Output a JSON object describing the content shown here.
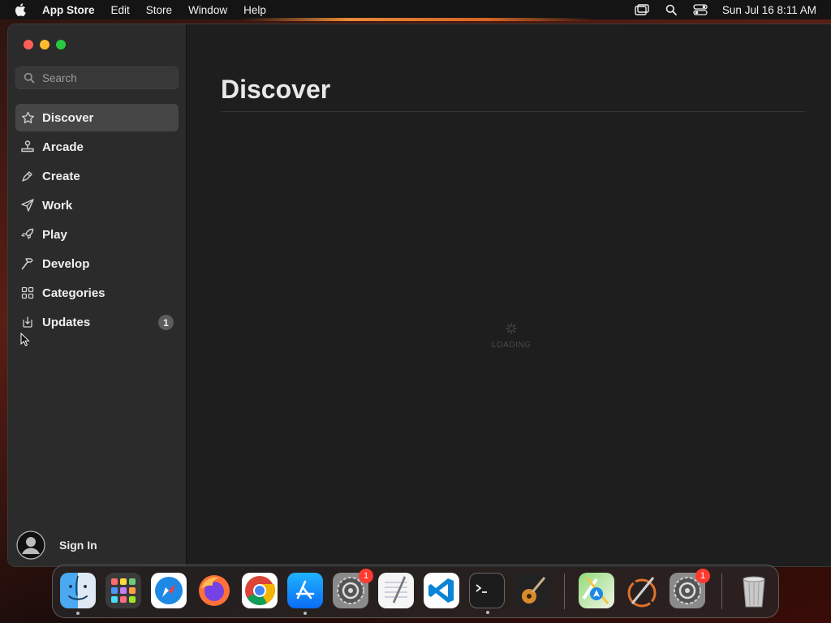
{
  "menubar": {
    "app_name": "App Store",
    "items": [
      "Edit",
      "Store",
      "Window",
      "Help"
    ],
    "clock": "Sun Jul 16  8:11 AM"
  },
  "sidebar": {
    "search_placeholder": "Search",
    "items": [
      {
        "label": "Discover",
        "icon": "star-icon",
        "active": true
      },
      {
        "label": "Arcade",
        "icon": "joystick-icon"
      },
      {
        "label": "Create",
        "icon": "brush-icon"
      },
      {
        "label": "Work",
        "icon": "paper-plane-icon"
      },
      {
        "label": "Play",
        "icon": "rocket-icon"
      },
      {
        "label": "Develop",
        "icon": "hammer-icon"
      },
      {
        "label": "Categories",
        "icon": "grid-icon"
      },
      {
        "label": "Updates",
        "icon": "download-icon",
        "badge": "1"
      }
    ],
    "sign_in": "Sign In"
  },
  "content": {
    "title": "Discover",
    "loading_text": "LOADING"
  },
  "dock": {
    "apps": [
      {
        "name": "finder-icon"
      },
      {
        "name": "launchpad-icon"
      },
      {
        "name": "safari-icon"
      },
      {
        "name": "firefox-icon"
      },
      {
        "name": "chrome-icon"
      },
      {
        "name": "app-store-icon"
      },
      {
        "name": "system-settings-icon",
        "badge": "1"
      },
      {
        "name": "textedit-icon"
      },
      {
        "name": "vscode-icon"
      },
      {
        "name": "terminal-icon"
      },
      {
        "name": "garageband-icon"
      },
      {
        "name": "maps-icon"
      },
      {
        "name": "xcode-icon"
      },
      {
        "name": "system-settings-icon",
        "badge": "1"
      },
      {
        "name": "trash-icon"
      }
    ]
  },
  "colors": {
    "close": "#ff5f57",
    "minimize": "#febc2e",
    "maximize": "#28c840",
    "badge_red": "#ff3b30"
  }
}
